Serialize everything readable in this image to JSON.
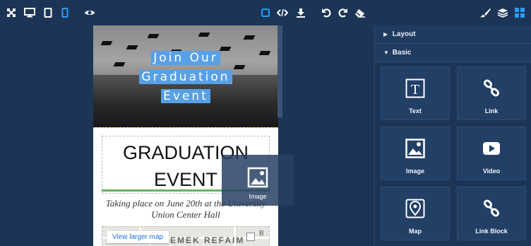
{
  "toolbar": {
    "left_icons": [
      "fullscreen-icon",
      "desktop-icon",
      "tablet-icon",
      "mobile-icon",
      "preview-eye-icon"
    ],
    "center_icons": [
      "component-outline-icon",
      "code-icon",
      "download-icon"
    ],
    "right_icons": [
      "undo-icon",
      "redo-icon",
      "eraser-icon"
    ],
    "panel_icons": [
      "style-brush-icon",
      "layers-icon",
      "blocks-grid-icon"
    ],
    "active_color": "#2a9cf4"
  },
  "canvas": {
    "hero": {
      "title_lines": [
        "Join Our",
        "Graduation",
        "Event"
      ]
    },
    "heading_lines": [
      "GRADUATION",
      "EVENT"
    ],
    "description_lines": [
      "Taking place on June 20th at the University",
      "Union Center Hall"
    ],
    "map": {
      "view_larger": "View larger map",
      "place_name": "EMEK REFAIM",
      "edge_letter": "B"
    },
    "drag_ghost": {
      "label": "Image",
      "icon": "image-icon"
    }
  },
  "panel": {
    "categories": [
      {
        "label": "Layout",
        "expanded": false
      },
      {
        "label": "Basic",
        "expanded": true
      }
    ],
    "blocks": [
      {
        "label": "Text",
        "icon": "text-icon"
      },
      {
        "label": "Link",
        "icon": "link-icon"
      },
      {
        "label": "Image",
        "icon": "image-icon"
      },
      {
        "label": "Video",
        "icon": "video-icon"
      },
      {
        "label": "Map",
        "icon": "map-pin-icon"
      },
      {
        "label": "Link Block",
        "icon": "link-block-icon"
      }
    ]
  }
}
